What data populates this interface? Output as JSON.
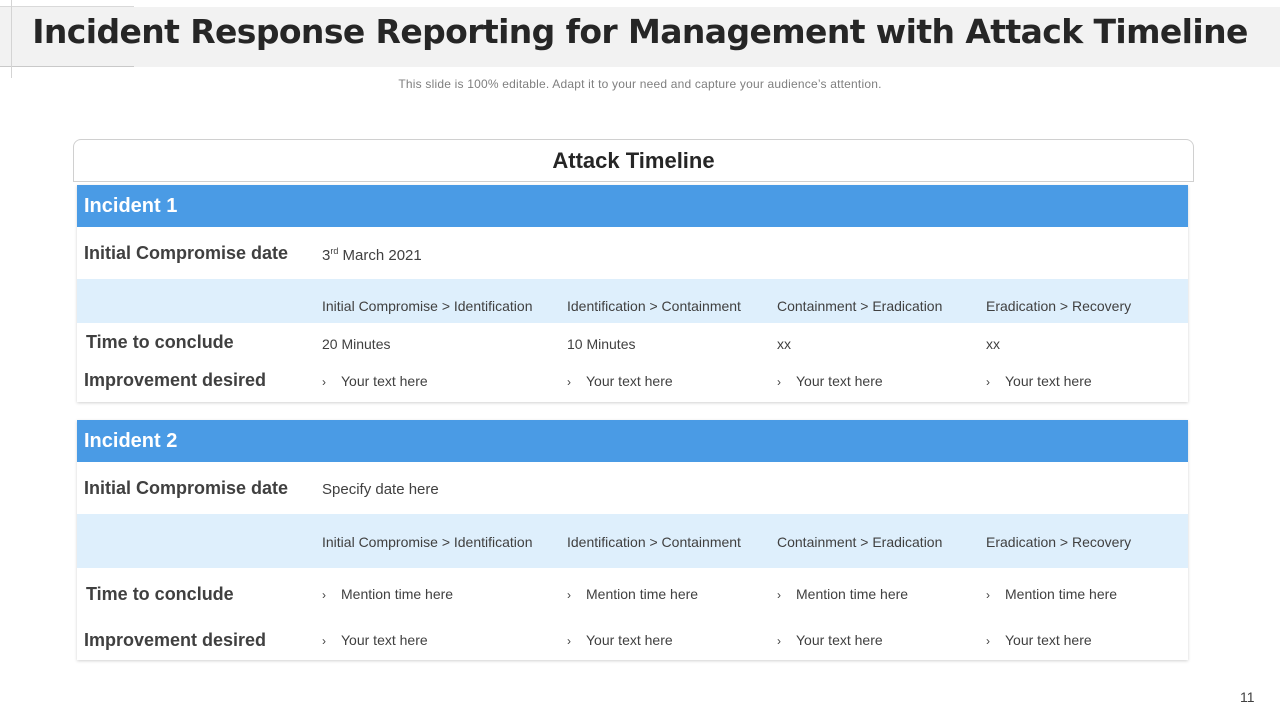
{
  "title": "Incident Response Reporting for Management with Attack Timeline",
  "subtitle": "This slide is 100% editable. Adapt it to your need and capture your audience’s attention.",
  "timeline_header": "Attack Timeline",
  "page_number": "11",
  "labels": {
    "initial_compromise_date": "Initial Compromise date",
    "time_to_conclude": "Time to conclude",
    "improvement_desired": "Improvement desired"
  },
  "phases": [
    "Initial Compromise > Identification",
    "Identification > Containment",
    "Containment > Eradication",
    "Eradication > Recovery"
  ],
  "bullet_glyph": "›",
  "incidents": [
    {
      "name": "Incident 1",
      "date_day": "3",
      "date_suffix": "rd",
      "date_rest": " March 2021",
      "times": [
        "20 Minutes",
        "10 Minutes",
        "xx",
        "xx"
      ],
      "improvements": [
        "Your text here",
        "Your text here",
        "Your text here",
        "Your text here"
      ]
    },
    {
      "name": "Incident 2",
      "date": "Specify date here",
      "times": [
        "Mention time here",
        "Mention time here",
        "Mention time here",
        "Mention time here"
      ],
      "improvements": [
        "Your text here",
        "Your text here",
        "Your text here",
        "Your text here"
      ]
    }
  ],
  "colors": {
    "incident_header": "#4a9be5",
    "phase_row": "#deeffc",
    "title_bar": "#f2f2f2"
  }
}
